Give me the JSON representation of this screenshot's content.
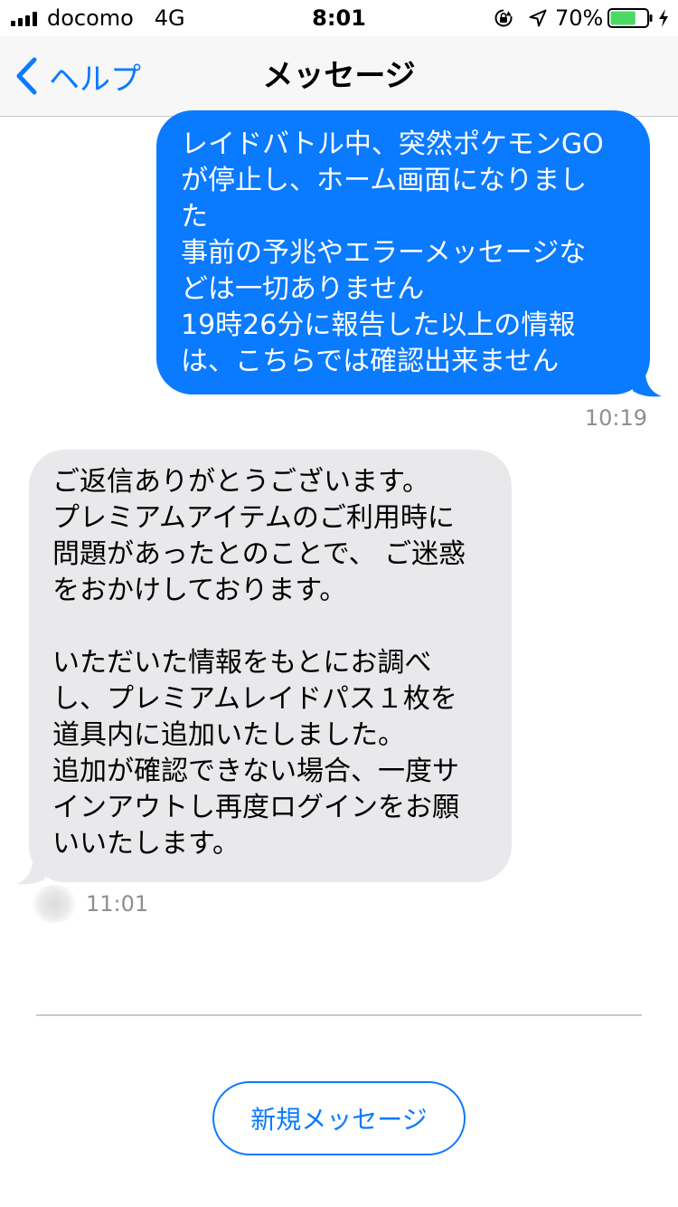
{
  "status_bar": {
    "carrier": "docomo",
    "network": "4G",
    "time": "8:01",
    "battery_percent": "70%",
    "battery_level": 0.7,
    "icons": [
      "signal-bars-icon",
      "orientation-lock-icon",
      "location-arrow-icon",
      "battery-icon",
      "charging-bolt-icon"
    ]
  },
  "nav": {
    "back_label": "ヘルプ",
    "title": "メッセージ"
  },
  "messages": [
    {
      "direction": "outgoing",
      "text": "レイドバトル中、突然ポケモンGO\nが停止し、ホーム画面になりまし\nた\n事前の予兆やエラーメッセージな\nどは一切ありません\n19時26分に報告した以上の情報\nは、こちらでは確認出来ません",
      "time": "10:19"
    },
    {
      "direction": "incoming",
      "text": "ご返信ありがとうございます。\nプレミアムアイテムのご利用時に\n問題があったとのことで、 ご迷惑\nをおかけしております。\n\nいただいた情報をもとにお調べ\nし、プレミアムレイドパス１枚を\n道具内に追加いたしました。\n追加が確認できない場合、一度サ\nインアウトし再度ログインをお願\nいいたします。",
      "time": "11:01"
    }
  ],
  "new_message_button": "新規メッセージ",
  "colors": {
    "accent": "#0a7aff",
    "incoming_bubble": "#e9e9eb",
    "battery_fill": "#4cd964"
  }
}
